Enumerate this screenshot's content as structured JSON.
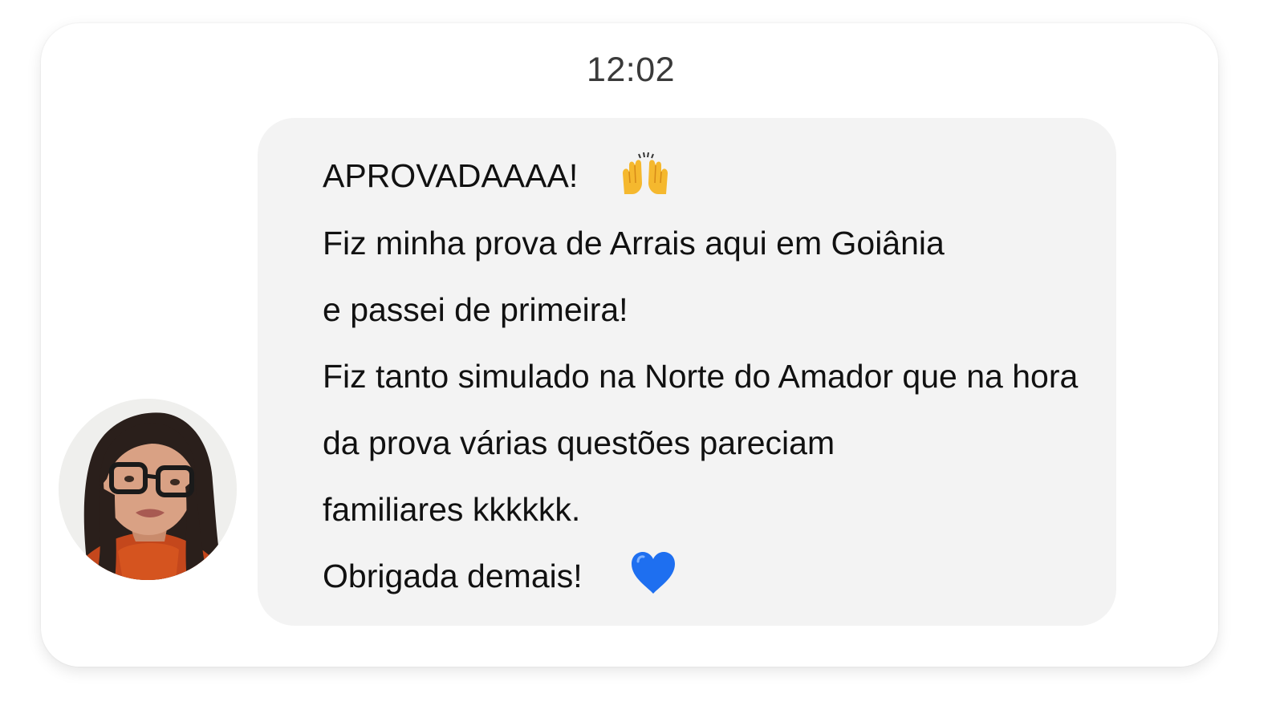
{
  "chat": {
    "timestamp": "12:02",
    "message": {
      "lines": [
        "APROVADAAAA!",
        "Fiz minha prova de Arrais aqui em Goiânia",
        "e passei de primeira!",
        "Fiz tanto simulado na Norte do Amador que na hora",
        "da prova várias questões pareciam",
        "familiares kkkkkk.",
        "Obrigada demais!"
      ],
      "emojis": [
        "raising-hands-icon",
        "blue-heart-icon"
      ]
    },
    "avatar": "user-avatar-photo"
  },
  "colors": {
    "bubble": "#f3f3f3",
    "heart": "#1e6ff0",
    "hands": "#f5b82e"
  }
}
